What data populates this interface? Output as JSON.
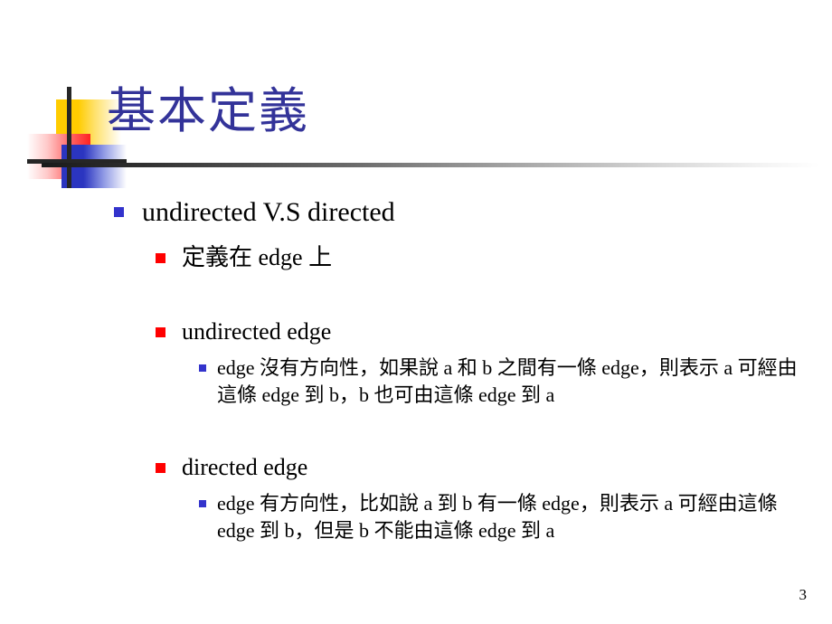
{
  "slide": {
    "title": "基本定義",
    "page_number": "3",
    "title_color": "#333399",
    "bullet_level1_color": "#3333CC",
    "bullet_level2_color": "#FF0000",
    "bullet_level3_color": "#3333CC",
    "logo": {
      "yellow": "#FFCC00",
      "red": "#FF2222",
      "blue": "#2B35C0",
      "cross": "#262626"
    }
  },
  "outline": {
    "item1": "undirected V.S directed",
    "item1_sub1": "定義在 edge 上",
    "item2": "undirected edge",
    "item2_detail": "edge 沒有方向性，如果說 a 和 b 之間有一條 edge，則表示 a 可經由這條 edge 到 b，b 也可由這條 edge 到 a",
    "item3": "directed edge",
    "item3_detail": "edge 有方向性，比如說 a 到 b 有一條 edge，則表示 a 可經由這條 edge 到 b，但是 b 不能由這條 edge 到 a"
  }
}
